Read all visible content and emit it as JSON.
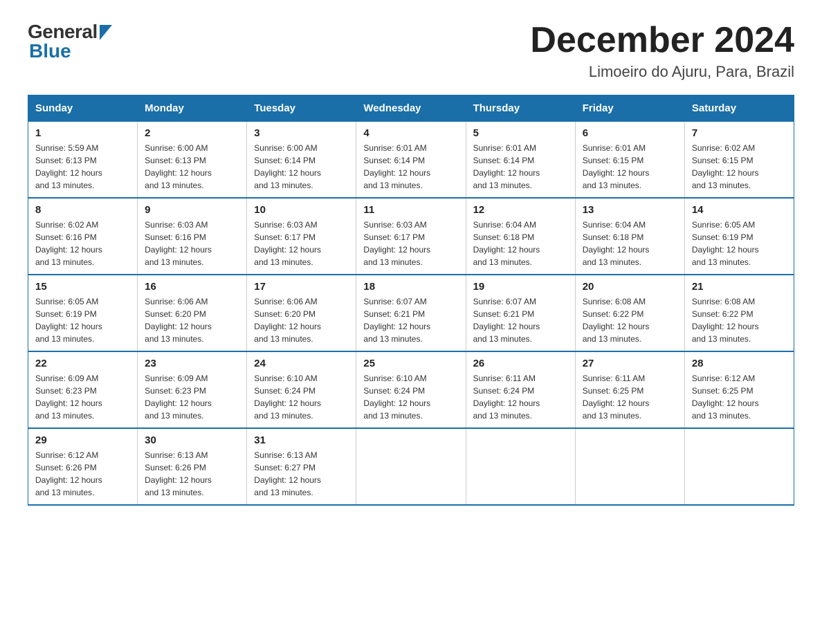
{
  "header": {
    "logo_general": "General",
    "logo_blue": "Blue",
    "month_title": "December 2024",
    "location": "Limoeiro do Ajuru, Para, Brazil"
  },
  "days_of_week": [
    "Sunday",
    "Monday",
    "Tuesday",
    "Wednesday",
    "Thursday",
    "Friday",
    "Saturday"
  ],
  "weeks": [
    [
      {
        "day": "1",
        "sunrise": "5:59 AM",
        "sunset": "6:13 PM",
        "daylight": "12 hours and 13 minutes."
      },
      {
        "day": "2",
        "sunrise": "6:00 AM",
        "sunset": "6:13 PM",
        "daylight": "12 hours and 13 minutes."
      },
      {
        "day": "3",
        "sunrise": "6:00 AM",
        "sunset": "6:14 PM",
        "daylight": "12 hours and 13 minutes."
      },
      {
        "day": "4",
        "sunrise": "6:01 AM",
        "sunset": "6:14 PM",
        "daylight": "12 hours and 13 minutes."
      },
      {
        "day": "5",
        "sunrise": "6:01 AM",
        "sunset": "6:14 PM",
        "daylight": "12 hours and 13 minutes."
      },
      {
        "day": "6",
        "sunrise": "6:01 AM",
        "sunset": "6:15 PM",
        "daylight": "12 hours and 13 minutes."
      },
      {
        "day": "7",
        "sunrise": "6:02 AM",
        "sunset": "6:15 PM",
        "daylight": "12 hours and 13 minutes."
      }
    ],
    [
      {
        "day": "8",
        "sunrise": "6:02 AM",
        "sunset": "6:16 PM",
        "daylight": "12 hours and 13 minutes."
      },
      {
        "day": "9",
        "sunrise": "6:03 AM",
        "sunset": "6:16 PM",
        "daylight": "12 hours and 13 minutes."
      },
      {
        "day": "10",
        "sunrise": "6:03 AM",
        "sunset": "6:17 PM",
        "daylight": "12 hours and 13 minutes."
      },
      {
        "day": "11",
        "sunrise": "6:03 AM",
        "sunset": "6:17 PM",
        "daylight": "12 hours and 13 minutes."
      },
      {
        "day": "12",
        "sunrise": "6:04 AM",
        "sunset": "6:18 PM",
        "daylight": "12 hours and 13 minutes."
      },
      {
        "day": "13",
        "sunrise": "6:04 AM",
        "sunset": "6:18 PM",
        "daylight": "12 hours and 13 minutes."
      },
      {
        "day": "14",
        "sunrise": "6:05 AM",
        "sunset": "6:19 PM",
        "daylight": "12 hours and 13 minutes."
      }
    ],
    [
      {
        "day": "15",
        "sunrise": "6:05 AM",
        "sunset": "6:19 PM",
        "daylight": "12 hours and 13 minutes."
      },
      {
        "day": "16",
        "sunrise": "6:06 AM",
        "sunset": "6:20 PM",
        "daylight": "12 hours and 13 minutes."
      },
      {
        "day": "17",
        "sunrise": "6:06 AM",
        "sunset": "6:20 PM",
        "daylight": "12 hours and 13 minutes."
      },
      {
        "day": "18",
        "sunrise": "6:07 AM",
        "sunset": "6:21 PM",
        "daylight": "12 hours and 13 minutes."
      },
      {
        "day": "19",
        "sunrise": "6:07 AM",
        "sunset": "6:21 PM",
        "daylight": "12 hours and 13 minutes."
      },
      {
        "day": "20",
        "sunrise": "6:08 AM",
        "sunset": "6:22 PM",
        "daylight": "12 hours and 13 minutes."
      },
      {
        "day": "21",
        "sunrise": "6:08 AM",
        "sunset": "6:22 PM",
        "daylight": "12 hours and 13 minutes."
      }
    ],
    [
      {
        "day": "22",
        "sunrise": "6:09 AM",
        "sunset": "6:23 PM",
        "daylight": "12 hours and 13 minutes."
      },
      {
        "day": "23",
        "sunrise": "6:09 AM",
        "sunset": "6:23 PM",
        "daylight": "12 hours and 13 minutes."
      },
      {
        "day": "24",
        "sunrise": "6:10 AM",
        "sunset": "6:24 PM",
        "daylight": "12 hours and 13 minutes."
      },
      {
        "day": "25",
        "sunrise": "6:10 AM",
        "sunset": "6:24 PM",
        "daylight": "12 hours and 13 minutes."
      },
      {
        "day": "26",
        "sunrise": "6:11 AM",
        "sunset": "6:24 PM",
        "daylight": "12 hours and 13 minutes."
      },
      {
        "day": "27",
        "sunrise": "6:11 AM",
        "sunset": "6:25 PM",
        "daylight": "12 hours and 13 minutes."
      },
      {
        "day": "28",
        "sunrise": "6:12 AM",
        "sunset": "6:25 PM",
        "daylight": "12 hours and 13 minutes."
      }
    ],
    [
      {
        "day": "29",
        "sunrise": "6:12 AM",
        "sunset": "6:26 PM",
        "daylight": "12 hours and 13 minutes."
      },
      {
        "day": "30",
        "sunrise": "6:13 AM",
        "sunset": "6:26 PM",
        "daylight": "12 hours and 13 minutes."
      },
      {
        "day": "31",
        "sunrise": "6:13 AM",
        "sunset": "6:27 PM",
        "daylight": "12 hours and 13 minutes."
      },
      null,
      null,
      null,
      null
    ]
  ],
  "labels": {
    "sunrise": "Sunrise:",
    "sunset": "Sunset:",
    "daylight": "Daylight:"
  }
}
